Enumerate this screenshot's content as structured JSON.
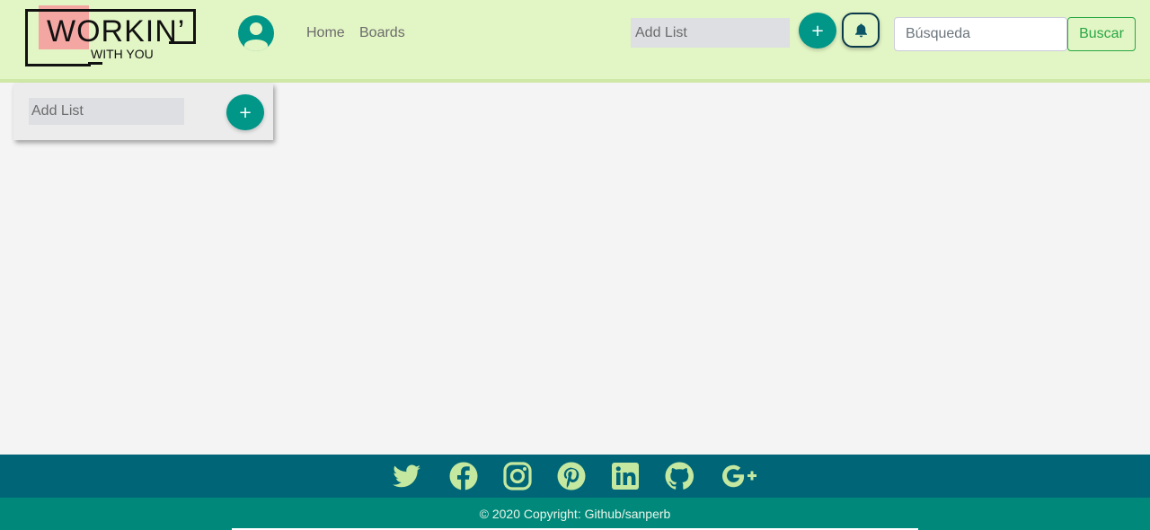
{
  "logo": {
    "main": "WORKIN’",
    "sub": "WITH YOU"
  },
  "nav": {
    "links": [
      "Home",
      "Boards"
    ]
  },
  "toolbar": {
    "add_list_placeholder": "Add List",
    "add_button_label": "+",
    "search_placeholder": "Búsqueda",
    "search_button": "Buscar"
  },
  "board": {
    "card_placeholder": "Add List",
    "card_add_label": "+"
  },
  "footer": {
    "social_icons": [
      "twitter-icon",
      "facebook-icon",
      "instagram-icon",
      "pinterest-icon",
      "linkedin-icon",
      "github-icon",
      "google-plus-icon"
    ],
    "copyright": "© 2020 Copyright: Github/sanperb"
  },
  "colors": {
    "navbar_bg": "#e2f5c4",
    "accent": "#009688",
    "footer_top": "#006677",
    "footer_bottom": "#00897b",
    "icon_color": "#c5e8a0",
    "search_green": "#28a745"
  }
}
